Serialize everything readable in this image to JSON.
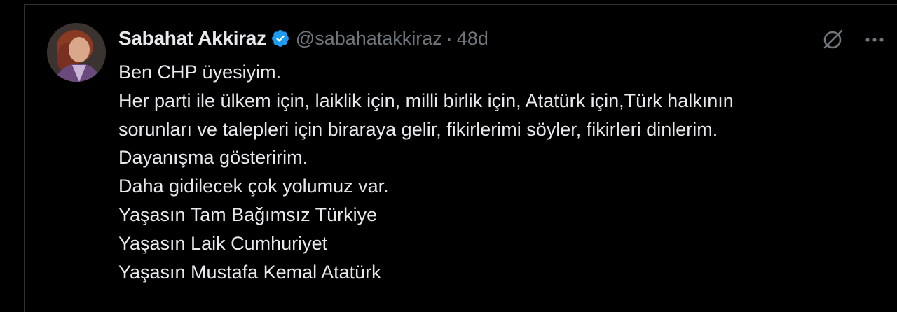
{
  "tweet": {
    "display_name": "Sabahat Akkiraz",
    "handle": "@sabahatakkiraz",
    "separator": "·",
    "time": "48d",
    "verified": true,
    "icons": {
      "verified": "verified-badge-icon",
      "grok": "grok-icon",
      "more": "more-options-icon",
      "avatar": "avatar"
    },
    "text_lines": [
      "Ben CHP üyesiyim.",
      "Her parti ile ülkem için, laiklik için, milli birlik için, Atatürk için,Türk halkının",
      "sorunları ve talepleri için biraraya gelir, fikirlerimi söyler, fikirleri dinlerim.",
      "Dayanışma gösteririm.",
      "Daha gidilecek çok yolumuz var.",
      "Yaşasın Tam Bağımsız Türkiye",
      "Yaşasın Laik Cumhuriyet",
      "Yaşasın Mustafa Kemal Atatürk"
    ]
  },
  "colors": {
    "background": "#000000",
    "text_primary": "#e7e9ea",
    "text_secondary": "#71767b",
    "verified_blue": "#1d9bf0",
    "border": "#2f3336"
  }
}
